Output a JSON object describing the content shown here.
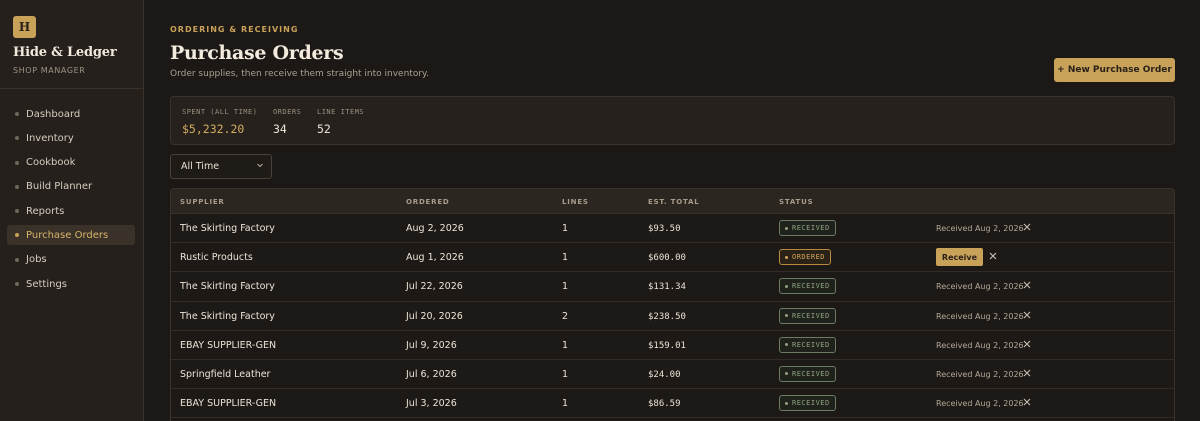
{
  "brand": {
    "logo_letter": "H",
    "name": "Hide & Ledger",
    "subtitle": "SHOP MANAGER"
  },
  "nav": [
    {
      "label": "Dashboard",
      "active": false
    },
    {
      "label": "Inventory",
      "active": false
    },
    {
      "label": "Cookbook",
      "active": false
    },
    {
      "label": "Build Planner",
      "active": false
    },
    {
      "label": "Reports",
      "active": false
    },
    {
      "label": "Purchase Orders",
      "active": true
    },
    {
      "label": "Jobs",
      "active": false
    },
    {
      "label": "Settings",
      "active": false
    }
  ],
  "header": {
    "eyebrow": "ORDERING & RECEIVING",
    "title": "Purchase Orders",
    "subtitle": "Order supplies, then receive them straight into inventory.",
    "new_button": "+ New Purchase Order"
  },
  "stats": [
    {
      "label": "SPENT (ALL TIME)",
      "value": "$5,232.20",
      "accent": true
    },
    {
      "label": "ORDERS",
      "value": "34",
      "accent": false
    },
    {
      "label": "LINE ITEMS",
      "value": "52",
      "accent": false
    }
  ],
  "filter": {
    "selected": "All Time"
  },
  "table": {
    "columns": [
      "SUPPLIER",
      "ORDERED",
      "LINES",
      "EST. TOTAL",
      "STATUS"
    ],
    "rows": [
      {
        "supplier": "The Skirting Factory",
        "ordered": "Aug 2, 2026",
        "lines": "1",
        "total": "$93.50",
        "status": "RECEIVED",
        "received": "Received Aug 2, 2026"
      },
      {
        "supplier": "Rustic Products",
        "ordered": "Aug 1, 2026",
        "lines": "1",
        "total": "$600.00",
        "status": "ORDERED",
        "action": "Receive"
      },
      {
        "supplier": "The Skirting Factory",
        "ordered": "Jul 22, 2026",
        "lines": "1",
        "total": "$131.34",
        "status": "RECEIVED",
        "received": "Received Aug 2, 2026"
      },
      {
        "supplier": "The Skirting Factory",
        "ordered": "Jul 20, 2026",
        "lines": "2",
        "total": "$238.50",
        "status": "RECEIVED",
        "received": "Received Aug 2, 2026"
      },
      {
        "supplier": "EBAY SUPPLIER-GEN",
        "ordered": "Jul 9, 2026",
        "lines": "1",
        "total": "$159.01",
        "status": "RECEIVED",
        "received": "Received Aug 2, 2026"
      },
      {
        "supplier": "Springfield Leather",
        "ordered": "Jul 6, 2026",
        "lines": "1",
        "total": "$24.00",
        "status": "RECEIVED",
        "received": "Received Aug 2, 2026"
      },
      {
        "supplier": "EBAY SUPPLIER-GEN",
        "ordered": "Jul 3, 2026",
        "lines": "1",
        "total": "$86.59",
        "status": "RECEIVED",
        "received": "Received Aug 2, 2026"
      }
    ]
  },
  "colors": {
    "accent": "#c9a25a",
    "background": "#1c1815",
    "received": "#8ea282",
    "ordered": "#d1a559"
  },
  "icons": {
    "close": "close-icon",
    "chevron": "chevron-down-icon"
  }
}
